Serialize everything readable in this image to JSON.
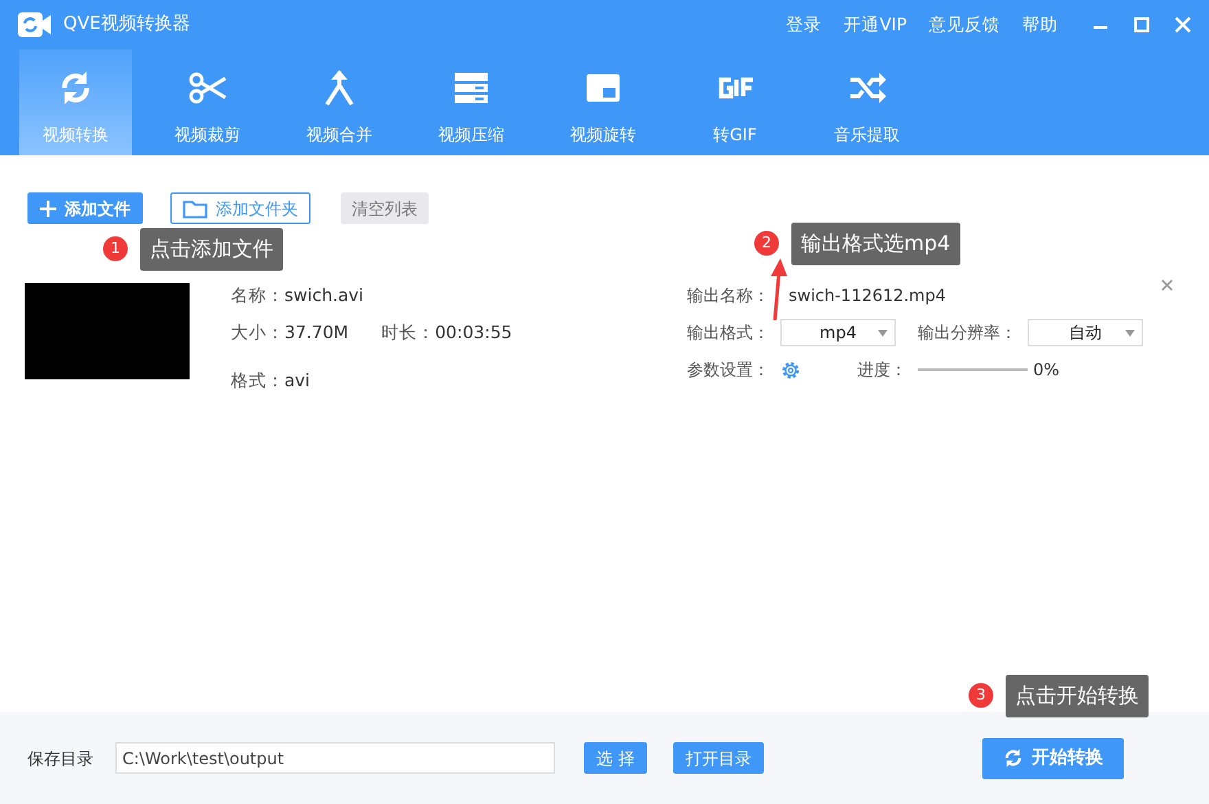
{
  "window": {
    "title": "QVE视频转换器",
    "menu": [
      "登录",
      "开通VIP",
      "意见反馈",
      "帮助"
    ]
  },
  "tabs": [
    {
      "label": "视频转换",
      "selected": true
    },
    {
      "label": "视频裁剪",
      "selected": false
    },
    {
      "label": "视频合并",
      "selected": false
    },
    {
      "label": "视频压缩",
      "selected": false
    },
    {
      "label": "视频旋转",
      "selected": false
    },
    {
      "label": "转GIF",
      "selected": false
    },
    {
      "label": "音乐提取",
      "selected": false
    }
  ],
  "toolbar": {
    "add_file": "添加文件",
    "add_folder": "添加文件夹",
    "clear": "清空列表"
  },
  "file": {
    "name_label": "名称：",
    "name": "swich.avi",
    "size_label": "大小：",
    "size": "37.70M",
    "duration_label": "时长：",
    "duration": "00:03:55",
    "format_label": "格式：",
    "format": "avi",
    "output_name_label": "输出名称：",
    "output_name": "swich-112612.mp4",
    "output_format_label": "输出格式：",
    "output_format": "mp4",
    "resolution_label": "输出分辨率：",
    "resolution": "自动",
    "params_label": "参数设置：",
    "progress_label": "进度：",
    "level": 0,
    "progress_reading": "0%"
  },
  "footer": {
    "save_label": "保存目录",
    "path": "C:\\Work\\test\\output",
    "choose": "选 择",
    "open": "打开目录",
    "start": "开始转换"
  },
  "annotations": [
    {
      "number": "1",
      "text": "点击添加文件"
    },
    {
      "number": "2",
      "text": "输出格式选mp4"
    },
    {
      "number": "3",
      "text": "点击开始转换"
    }
  ]
}
